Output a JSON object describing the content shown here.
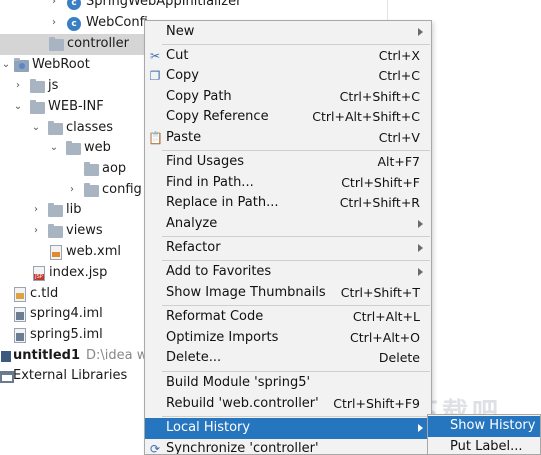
{
  "tree": {
    "items": [
      {
        "label": "SpringWebAppInitializer",
        "icon": "class-icon"
      },
      {
        "label": "WebConfi",
        "icon": "class-icon"
      },
      {
        "label": "controller",
        "icon": "package-folder-icon"
      },
      {
        "label": "WebRoot",
        "icon": "web-folder-icon"
      },
      {
        "label": "js",
        "icon": "folder-icon"
      },
      {
        "label": "WEB-INF",
        "icon": "folder-icon"
      },
      {
        "label": "classes",
        "icon": "folder-icon"
      },
      {
        "label": "web",
        "icon": "folder-icon"
      },
      {
        "label": "aop",
        "icon": "folder-icon"
      },
      {
        "label": "config",
        "icon": "folder-icon"
      },
      {
        "label": "lib",
        "icon": "folder-icon"
      },
      {
        "label": "views",
        "icon": "folder-icon"
      },
      {
        "label": "web.xml",
        "icon": "xml-file-icon"
      },
      {
        "label": "index.jsp",
        "icon": "jsp-file-icon"
      },
      {
        "label": "c.tld",
        "icon": "tld-file-icon"
      },
      {
        "label": "spring4.iml",
        "icon": "iml-file-icon"
      },
      {
        "label": "spring5.iml",
        "icon": "iml-file-icon"
      },
      {
        "label": "untitled1",
        "path": "D:\\idea wo",
        "icon": "module-icon"
      },
      {
        "label": "External Libraries",
        "icon": "library-icon"
      }
    ]
  },
  "context_menu": {
    "items": [
      {
        "label": "New",
        "shortcut": ""
      },
      {
        "label": "Cut",
        "shortcut": "Ctrl+X",
        "icon": "scissors-icon"
      },
      {
        "label": "Copy",
        "shortcut": "Ctrl+C",
        "icon": "copy-icon"
      },
      {
        "label": "Copy Path",
        "shortcut": "Ctrl+Shift+C"
      },
      {
        "label": "Copy Reference",
        "shortcut": "Ctrl+Alt+Shift+C"
      },
      {
        "label": "Paste",
        "shortcut": "Ctrl+V",
        "icon": "paste-icon"
      },
      {
        "label": "Find Usages",
        "shortcut": "Alt+F7"
      },
      {
        "label": "Find in Path...",
        "shortcut": "Ctrl+Shift+F"
      },
      {
        "label": "Replace in Path...",
        "shortcut": "Ctrl+Shift+R"
      },
      {
        "label": "Analyze",
        "shortcut": ""
      },
      {
        "label": "Refactor",
        "shortcut": ""
      },
      {
        "label": "Add to Favorites",
        "shortcut": ""
      },
      {
        "label": "Show Image Thumbnails",
        "shortcut": "Ctrl+Shift+T"
      },
      {
        "label": "Reformat Code",
        "shortcut": "Ctrl+Alt+L"
      },
      {
        "label": "Optimize Imports",
        "shortcut": "Ctrl+Alt+O"
      },
      {
        "label": "Delete...",
        "shortcut": "Delete"
      },
      {
        "label": "Build Module 'spring5'",
        "shortcut": ""
      },
      {
        "label": "Rebuild 'web.controller'",
        "shortcut": "Ctrl+Shift+F9"
      },
      {
        "label": "Local History",
        "shortcut": ""
      },
      {
        "label": "Synchronize 'controller'",
        "shortcut": "",
        "icon": "sync-icon"
      }
    ]
  },
  "submenu": {
    "items": [
      {
        "label": "Show History"
      },
      {
        "label": "Put Label..."
      }
    ]
  },
  "watermark": {
    "text": "下载吧"
  },
  "colors": {
    "accent": "#2675bf",
    "menu_bg": "#f2f2f2",
    "selection": "#d5d5d5"
  }
}
